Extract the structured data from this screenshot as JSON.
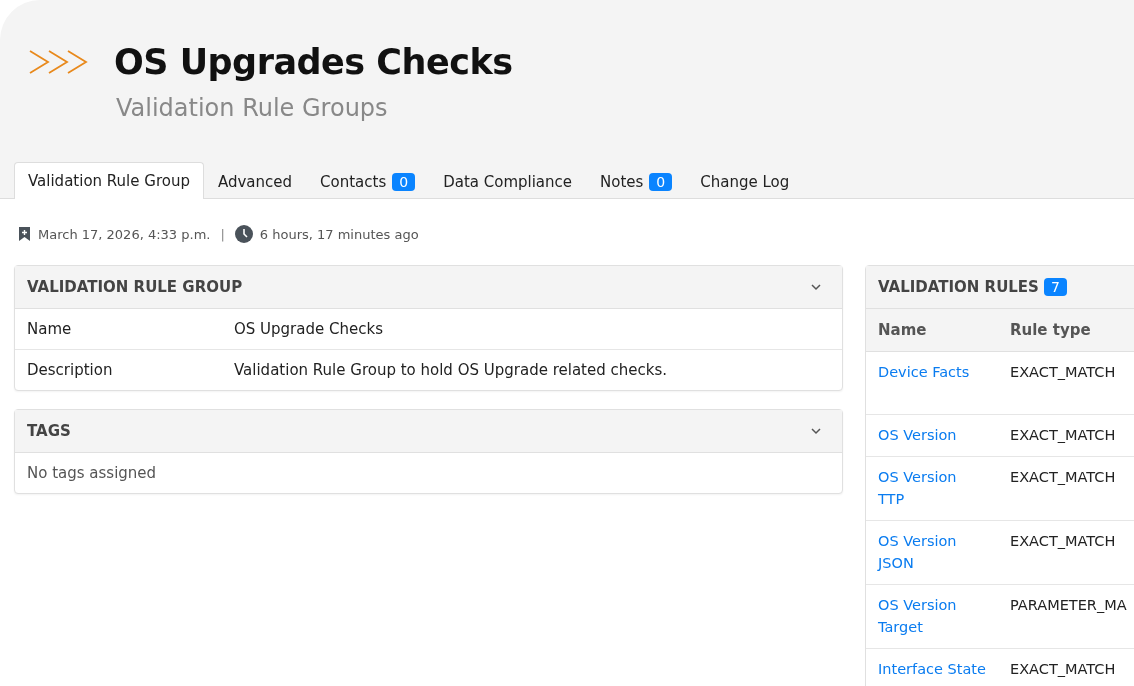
{
  "header": {
    "title": "OS Upgrades Checks",
    "subtitle": "Validation Rule Groups"
  },
  "tabs": [
    {
      "label": "Validation Rule Group",
      "selected": true
    },
    {
      "label": "Advanced",
      "selected": false
    },
    {
      "label": "Contacts",
      "badge": "0",
      "selected": false
    },
    {
      "label": "Data Compliance",
      "selected": false
    },
    {
      "label": "Notes",
      "badge": "0",
      "selected": false
    },
    {
      "label": "Change Log",
      "selected": false
    }
  ],
  "meta": {
    "created": "March 17, 2026, 4:33 p.m.",
    "separator": "|",
    "updated": "6 hours, 17 minutes ago"
  },
  "group_panel": {
    "title": "VALIDATION RULE GROUP",
    "expanded": true,
    "rows": [
      {
        "label": "Name",
        "value": "OS Upgrade Checks"
      },
      {
        "label": "Description",
        "value": "Validation Rule Group to hold OS Upgrade related checks."
      }
    ]
  },
  "tags_panel": {
    "title": "TAGS",
    "expanded": true,
    "empty_text": "No tags assigned"
  },
  "rules_panel": {
    "title": "VALIDATION RULES",
    "count": "7",
    "columns": [
      "Name",
      "Rule type"
    ],
    "rows": [
      {
        "name": "Device Facts",
        "rule_type": "EXACT_MATCH"
      },
      {
        "name": "OS Version",
        "rule_type": "EXACT_MATCH"
      },
      {
        "name": "OS Version TTP",
        "rule_type": "EXACT_MATCH"
      },
      {
        "name": "OS Version JSON",
        "rule_type": "EXACT_MATCH"
      },
      {
        "name": "OS Version Target",
        "rule_type": "PARAMETER_MA"
      },
      {
        "name": "Interface State",
        "rule_type": "EXACT_MATCH"
      }
    ]
  }
}
